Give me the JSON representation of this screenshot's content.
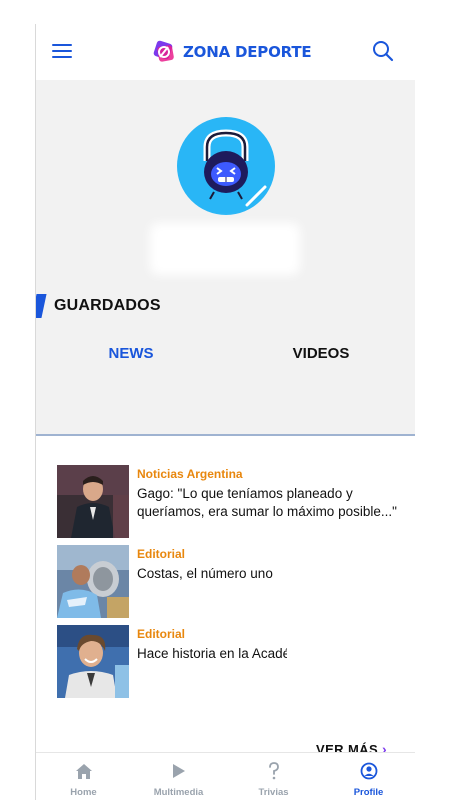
{
  "header": {
    "brand": "ZONA DEPORTE",
    "menu_icon": "hamburger-menu-icon",
    "search_icon": "search-icon"
  },
  "profile": {
    "avatar_icon": "kettlebell-mascot-icon",
    "saved_title": "GUARDADOS"
  },
  "tabs": [
    {
      "label": "NEWS",
      "active": true
    },
    {
      "label": "VIDEOS",
      "active": false
    }
  ],
  "news": [
    {
      "category": "Noticias Argentina",
      "title": "Gago: \"Lo que teníamos planeado y queríamos, era sumar lo máximo posible...\""
    },
    {
      "category": "Editorial",
      "title": "Costas, el número uno"
    },
    {
      "category": "Editorial",
      "title": "Hace historia en la Académica"
    }
  ],
  "ver_mas": "VER MÁS",
  "bottom_nav": [
    {
      "label": "Home",
      "icon": "home-icon"
    },
    {
      "label": "Multimedia",
      "icon": "play-icon"
    },
    {
      "label": "Trivias",
      "icon": "question-icon"
    },
    {
      "label": "Profile",
      "icon": "profile-icon",
      "active": true
    }
  ],
  "colors": {
    "brand_blue": "#1a56db",
    "category_orange": "#e8870e",
    "avatar_bg": "#29b6f6",
    "accent_purple": "#7c3aed"
  }
}
